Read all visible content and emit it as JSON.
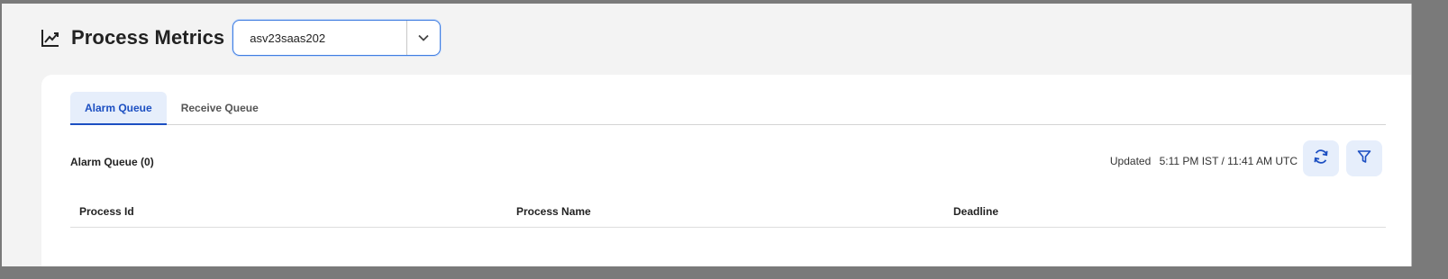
{
  "header": {
    "title": "Process Metrics",
    "icon": "trending-up-icon",
    "server_select": {
      "value": "asv23saas202",
      "icon": "chevron-down-icon"
    }
  },
  "tabs": [
    {
      "label": "Alarm Queue",
      "active": true
    },
    {
      "label": "Receive Queue",
      "active": false
    }
  ],
  "section": {
    "title": "Alarm Queue (0)",
    "updated_label": "Updated",
    "updated_value": "5:11 PM IST / 11:41 AM UTC",
    "refresh_icon": "refresh-icon",
    "filter_icon": "filter-icon"
  },
  "table": {
    "columns": [
      "Process Id",
      "Process Name",
      "Deadline"
    ],
    "rows": []
  },
  "colors": {
    "accent": "#1c4fc2",
    "accent_light": "#e6eefb",
    "select_border": "#3f7de0"
  }
}
